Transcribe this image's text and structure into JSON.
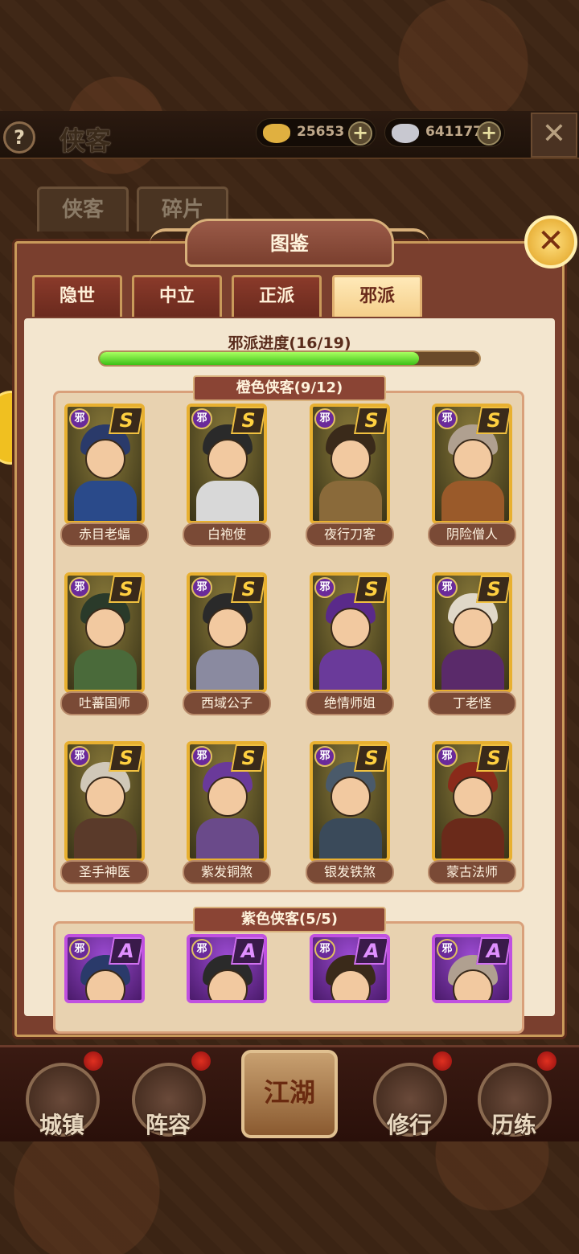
{
  "header": {
    "title": "侠客",
    "help_label": "?",
    "currency": [
      {
        "name": "gold-ingot",
        "value": "25653",
        "color": "#e0b040"
      },
      {
        "name": "silver-ingot",
        "value": "641177",
        "color": "#c8c8d0"
      }
    ],
    "close_label": "✕"
  },
  "main_tabs": [
    "侠客",
    "碎片"
  ],
  "panel": {
    "title": "图鉴",
    "close_label": "✕",
    "faction_tabs": [
      "隐世",
      "中立",
      "正派",
      "邪派"
    ],
    "active_faction": "邪派",
    "progress": {
      "label": "邪派进度(16/19)",
      "fraction": 0.842
    }
  },
  "sections": [
    {
      "title": "橙色侠客(9/12)",
      "grade": "S",
      "rarity": "orange",
      "heroes": [
        {
          "faction": "邪",
          "name": "赤目老蝠"
        },
        {
          "faction": "邪",
          "name": "白袍使"
        },
        {
          "faction": "邪",
          "name": "夜行刀客"
        },
        {
          "faction": "邪",
          "name": "阴险僧人"
        },
        {
          "faction": "邪",
          "name": "吐蕃国师"
        },
        {
          "faction": "邪",
          "name": "西域公子"
        },
        {
          "faction": "邪",
          "name": "绝情师姐"
        },
        {
          "faction": "邪",
          "name": "丁老怪"
        },
        {
          "faction": "邪",
          "name": "圣手神医"
        },
        {
          "faction": "邪",
          "name": "紫发铜煞"
        },
        {
          "faction": "邪",
          "name": "银发铁煞"
        },
        {
          "faction": "邪",
          "name": "蒙古法师"
        }
      ]
    },
    {
      "title": "紫色侠客(5/5)",
      "grade": "A",
      "rarity": "purple",
      "heroes": [
        {
          "faction": "邪"
        },
        {
          "faction": "邪"
        },
        {
          "faction": "邪"
        },
        {
          "faction": "邪"
        }
      ]
    }
  ],
  "bottom_nav": [
    "城镇",
    "阵容",
    "江湖",
    "修行",
    "历练"
  ]
}
